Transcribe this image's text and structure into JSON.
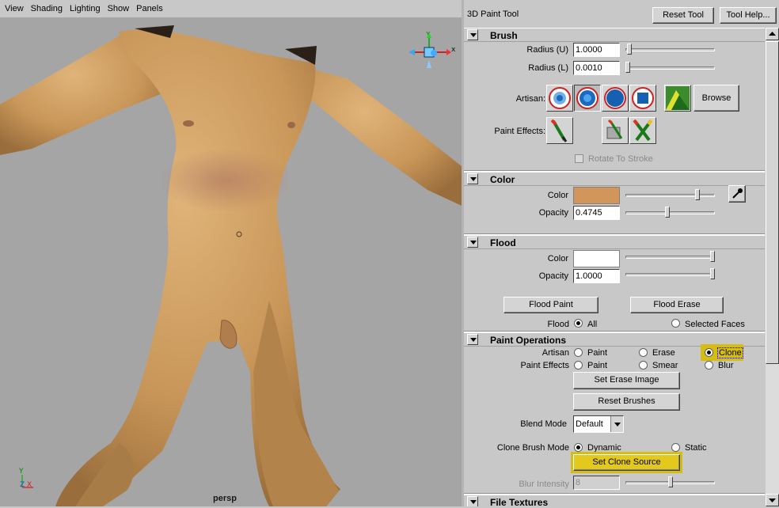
{
  "viewport": {
    "menu": [
      "View",
      "Shading",
      "Lighting",
      "Show",
      "Panels"
    ],
    "camera_label": "persp",
    "axes": {
      "y": "Y",
      "z": "Z",
      "x": "X"
    }
  },
  "panel": {
    "tool_title": "3D Paint Tool",
    "reset_tool": "Reset Tool",
    "tool_help": "Tool Help...",
    "brush": {
      "title": "Brush",
      "radius_u_label": "Radius (U)",
      "radius_u_value": "1.0000",
      "radius_u_level": 0.02,
      "radius_l_label": "Radius (L)",
      "radius_l_value": "0.0010",
      "radius_l_level": 0.0,
      "artisan_label": "Artisan:",
      "browse": "Browse",
      "paint_effects_label": "Paint Effects:",
      "rotate_to_stroke": "Rotate To Stroke"
    },
    "color": {
      "title": "Color",
      "color_label": "Color",
      "swatch": "#d2955a",
      "color_level": 0.82,
      "opacity_label": "Opacity",
      "opacity_value": "0.4745",
      "opacity_level": 0.47
    },
    "flood": {
      "title": "Flood",
      "color_label": "Color",
      "swatch": "#ffffff",
      "color_level": 1.0,
      "opacity_label": "Opacity",
      "opacity_value": "1.0000",
      "opacity_level": 1.0,
      "flood_paint": "Flood Paint",
      "flood_erase": "Flood Erase",
      "flood_label": "Flood",
      "all": "All",
      "selected_faces": "Selected Faces"
    },
    "paint_ops": {
      "title": "Paint Operations",
      "artisan_label": "Artisan",
      "paint": "Paint",
      "erase": "Erase",
      "clone": "Clone",
      "pe_label": "Paint Effects",
      "pe_paint": "Paint",
      "smear": "Smear",
      "blur": "Blur",
      "set_erase_image": "Set Erase Image",
      "reset_brushes": "Reset Brushes",
      "blend_mode_label": "Blend Mode",
      "blend_mode_value": "Default",
      "clone_mode_label": "Clone Brush Mode",
      "dynamic": "Dynamic",
      "static": "Static",
      "set_clone_source": "Set Clone Source",
      "blur_intensity_label": "Blur Intensity",
      "blur_intensity_value": "8",
      "blur_level": 0.5
    },
    "file_textures": {
      "title": "File Textures"
    }
  },
  "colors": {
    "highlight": "#d6bd14",
    "viewport_bg": "#a5a5a5",
    "skin": "#c99a5e"
  }
}
